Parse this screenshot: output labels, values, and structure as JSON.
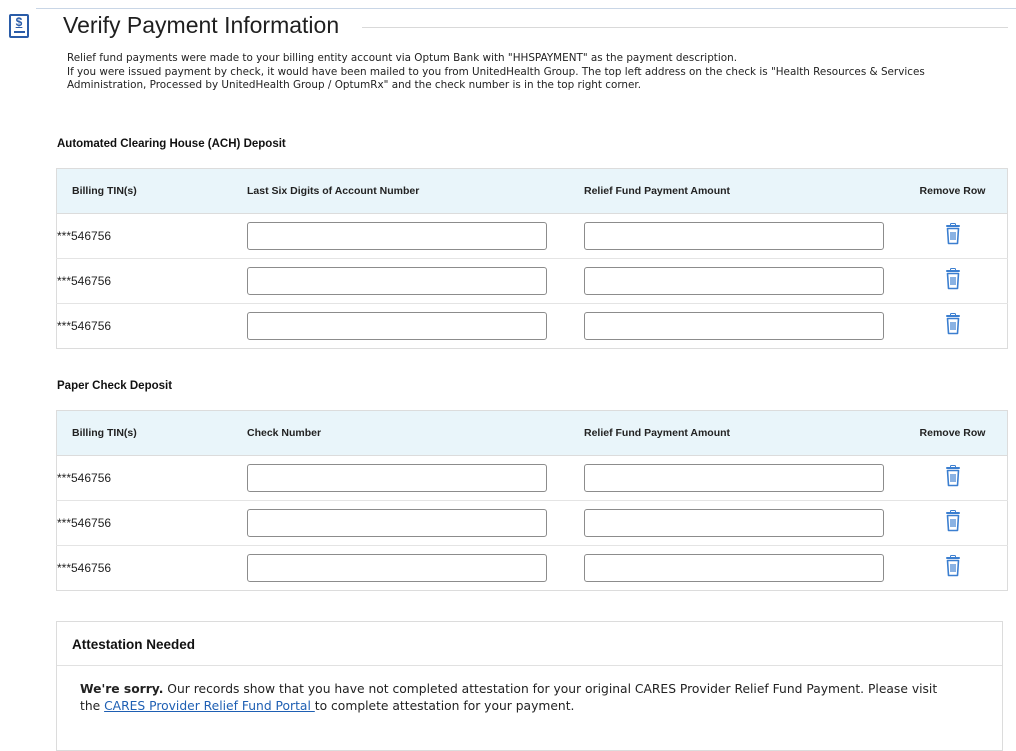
{
  "header": {
    "title": "Verify Payment Information",
    "intro_line1": "Relief fund payments were made to your billing entity account via Optum Bank with \"HHSPAYMENT\" as the payment description.",
    "intro_line2": "If you were issued payment by check, it would have been mailed to you from UnitedHealth Group. The top left address on the check is \"Health Resources & Services Administration, Processed by UnitedHealth Group / OptumRx\" and the check number is in the top right corner."
  },
  "ach": {
    "heading": "Automated Clearing House (ACH) Deposit",
    "columns": [
      "Billing TIN(s)",
      "Last Six Digits of Account Number",
      "Relief Fund Payment Amount",
      "Remove Row"
    ],
    "rows": [
      {
        "tin": "***546756",
        "account": "",
        "amount": ""
      },
      {
        "tin": "***546756",
        "account": "",
        "amount": ""
      },
      {
        "tin": "***546756",
        "account": "",
        "amount": ""
      }
    ]
  },
  "check": {
    "heading": "Paper Check Deposit",
    "columns": [
      "Billing TIN(s)",
      "Check Number",
      "Relief Fund Payment Amount",
      "Remove Row"
    ],
    "rows": [
      {
        "tin": "***546756",
        "check_number": "",
        "amount": ""
      },
      {
        "tin": "***546756",
        "check_number": "",
        "amount": ""
      },
      {
        "tin": "***546756",
        "check_number": "",
        "amount": ""
      }
    ]
  },
  "attestation": {
    "title": "Attestation Needed",
    "sorry": "We're sorry.",
    "body_before": " Our records show that you have not completed attestation for your original CARES Provider Relief Fund Payment. Please visit the ",
    "link_text": "CARES Provider Relief Fund Portal ",
    "body_after": "to complete attestation for your payment."
  },
  "icons": {
    "page": "dollar-document-icon",
    "remove": "trash-icon"
  },
  "colors": {
    "header_bg": "#e9f5fa",
    "icon_blue": "#2a5ca8",
    "link": "#1e5fb3"
  }
}
